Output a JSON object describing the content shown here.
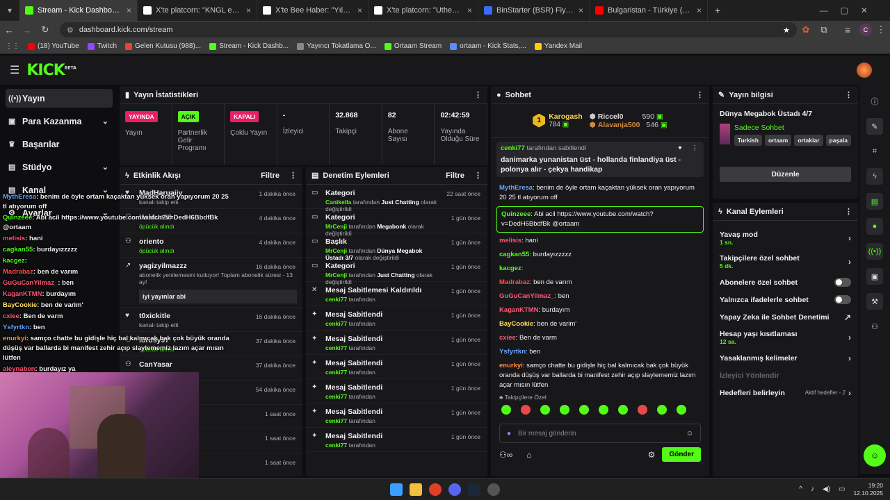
{
  "browser": {
    "tabs": [
      {
        "title": "Stream - Kick Dashboard",
        "icon": "kick-favicon",
        "color": "#53fc18"
      },
      {
        "title": "X'te platcorn: \"KNGL ekibiyle g...",
        "icon": "x-favicon",
        "color": "#ffffff"
      },
      {
        "title": "X'te Bee Haber: \"Yıldız Tilbe, m...",
        "icon": "x-favicon",
        "color": "#ffffff"
      },
      {
        "title": "X'te platcorn: \"Uthenera, KNGL...",
        "icon": "x-favicon",
        "color": "#ffffff"
      },
      {
        "title": "BinStarter (BSR) Fiyatı, Grafikler...",
        "icon": "binstarter-favicon",
        "color": "#3b6cff"
      },
      {
        "title": "Bulgaristan - Türkiye (1-6) Maç...",
        "icon": "youtube-favicon",
        "color": "#ff0000"
      }
    ],
    "url": "dashboard.kick.com/stream",
    "profile_initial": "C",
    "bookmarks": [
      {
        "label": "(18) YouTube",
        "color": "#ff0000"
      },
      {
        "label": "Twitch",
        "color": "#9146ff"
      },
      {
        "label": "Gelen Kutusu (988)...",
        "color": "#ea4335"
      },
      {
        "label": "Stream - Kick Dashb...",
        "color": "#53fc18"
      },
      {
        "label": "Yayıncı Tokatlama O...",
        "color": "#888888"
      },
      {
        "label": "Ortaam Stream",
        "color": "#53fc18"
      },
      {
        "label": "ortaam - Kick Stats,...",
        "color": "#5a8cff"
      },
      {
        "label": "Yandex Mail",
        "color": "#ffcc00"
      }
    ]
  },
  "topnav": {
    "logo": "KICK",
    "logo_sup": "BETA"
  },
  "sidebar": {
    "items": [
      {
        "label": "Yayın",
        "icon": "broadcast-icon",
        "active": true
      },
      {
        "label": "Para Kazanma",
        "icon": "money-icon",
        "chev": true
      },
      {
        "label": "Başarılar",
        "icon": "trophy-icon"
      },
      {
        "label": "Stüdyo",
        "icon": "studio-icon",
        "chev": true
      },
      {
        "label": "Kanal",
        "icon": "channel-icon",
        "chev": true
      },
      {
        "label": "Ayarlar",
        "icon": "gear-icon",
        "chev": true
      }
    ]
  },
  "stats_panel": {
    "title": "Yayın İstatistikleri",
    "items": [
      {
        "badge": "YAYINDA",
        "badge_color": "#e91e63",
        "label": "Yayın"
      },
      {
        "badge": "AÇIK",
        "badge_color": "#53fc18",
        "label": "Partnerlik Gelir Programı"
      },
      {
        "badge": "KAPALI",
        "badge_color": "#e91e63",
        "label": "Çoklu Yayın"
      },
      {
        "value": "-",
        "label": "İzleyici"
      },
      {
        "value": "32.868",
        "label": "Takipçi"
      },
      {
        "value": "82",
        "label": "Abone Sayısı"
      },
      {
        "value": "02:42:59",
        "label": "Yayında Olduğu Süre"
      }
    ]
  },
  "activity": {
    "title": "Etkinlik Akışı",
    "filter": "Filtre",
    "events": [
      {
        "name": "MadHaruaijy",
        "sub": "kanalı takip etti",
        "time": "1 dakika önce",
        "icon": "heart-icon"
      },
      {
        "name": "Haldun90",
        "sub": "öpücük alındı",
        "time": "4 dakika önce",
        "icon": "kiss-icon"
      },
      {
        "name": "oriento",
        "sub": "öpücük alındı",
        "time": "4 dakika önce",
        "icon": "kiss-icon"
      },
      {
        "name": "yagizyilmazzz",
        "sub": "abonelik yenilemesini kutluyor! Toplam abonelik süresi - 13 ay!",
        "time": "16 dakika önce",
        "icon": "sub-icon",
        "note": "iyi yayınlar abi"
      },
      {
        "name": "t0xickitle",
        "sub": "kanalı takip etti",
        "time": "16 dakika önce",
        "icon": "heart-icon"
      },
      {
        "name": "lordsy97",
        "sub": "öpücük alındı",
        "time": "37 dakika önce",
        "icon": "kiss-icon"
      },
      {
        "name": "CanYasar",
        "sub": "",
        "time": "37 dakika önce",
        "icon": "kiss-icon"
      },
      {
        "name": "",
        "sub": "",
        "time": "54 dakika önce",
        "icon": ""
      },
      {
        "name": "",
        "sub": "",
        "time": "1 saat önce",
        "icon": ""
      },
      {
        "name": "",
        "sub": "",
        "time": "1 saat önce",
        "icon": ""
      },
      {
        "name": "",
        "sub": "",
        "time": "1 saat önce",
        "icon": ""
      }
    ]
  },
  "moderation": {
    "title": "Denetim Eylemleri",
    "filter": "Filtre",
    "events": [
      {
        "name": "Kategori",
        "user": "Canikella",
        "mid": "tarafından",
        "target": "Just Chatting",
        "tail": "olarak değiştirildi",
        "time": "22 saat önce",
        "icon": "category-icon"
      },
      {
        "name": "Kategori",
        "user": "MrCenji",
        "mid": "tarafından",
        "target": "Megabonk",
        "tail": "olarak değiştirildi",
        "time": "1 gün önce",
        "icon": "category-icon"
      },
      {
        "name": "Başlık",
        "user": "MrCenji",
        "mid": "tarafından",
        "target": "Dünya Megabok Üstadı 3/7",
        "tail": "olarak değiştirildi",
        "time": "1 gün önce",
        "icon": "title-icon"
      },
      {
        "name": "Kategori",
        "user": "MrCenji",
        "mid": "tarafından",
        "target": "Just Chatting",
        "tail": "olarak değiştirildi",
        "time": "1 gün önce",
        "icon": "category-icon"
      },
      {
        "name": "Mesaj Sabitlemesi Kaldırıldı",
        "user": "cenki77",
        "mid": "tarafından",
        "target": "",
        "tail": "",
        "time": "1 gün önce",
        "icon": "unpin-icon"
      },
      {
        "name": "Mesaj Sabitlendi",
        "user": "cenki77",
        "mid": "tarafından",
        "target": "",
        "tail": "",
        "time": "1 gün önce",
        "icon": "pin-icon"
      },
      {
        "name": "Mesaj Sabitlendi",
        "user": "cenki77",
        "mid": "tarafından",
        "target": "",
        "tail": "",
        "time": "1 gün önce",
        "icon": "pin-icon"
      },
      {
        "name": "Mesaj Sabitlendi",
        "user": "cenki77",
        "mid": "tarafından",
        "target": "",
        "tail": "",
        "time": "1 gün önce",
        "icon": "pin-icon"
      },
      {
        "name": "Mesaj Sabitlendi",
        "user": "cenki77",
        "mid": "tarafından",
        "target": "",
        "tail": "",
        "time": "1 gün önce",
        "icon": "pin-icon"
      },
      {
        "name": "Mesaj Sabitlendi",
        "user": "cenki77",
        "mid": "tarafından",
        "target": "",
        "tail": "",
        "time": "1 gün önce",
        "icon": "pin-icon"
      },
      {
        "name": "Mesaj Sabitlendi",
        "user": "cenki77",
        "mid": "tarafından",
        "target": "",
        "tail": "",
        "time": "1 gün önce",
        "icon": "pin-icon"
      }
    ]
  },
  "chat": {
    "title": "Sohbet",
    "leaders": [
      {
        "rank": "1",
        "name": "Karogash",
        "value": "784"
      },
      {
        "rank": "",
        "name": "Riccel0",
        "value": "590"
      },
      {
        "rank": "",
        "name": "Alavanja500",
        "value": "546"
      }
    ],
    "pinned": {
      "user": "cenki77",
      "by": "tarafından sabitlendi",
      "text": "danimarka yunanistan üst - hollanda finlandiya üst -polonya alır - çekya handikap"
    },
    "messages": [
      {
        "user": "MythEresa",
        "cls": "nm-b",
        "text": ": benim de öyle ortam kaçaktan yüksek oran yapıyorum 20 25 tl atıyorum off"
      },
      {
        "user": "Quinzeee",
        "cls": "nm-g",
        "text": ": Abi acil https://www.youtube.com/watch?v=DedH6BbdfBk @ortaam",
        "highlight": true
      },
      {
        "user": "melisis",
        "cls": "nm-p",
        "text": ": hani"
      },
      {
        "user": "cagkan55",
        "cls": "nm-g",
        "text": ": burdayızzzzz"
      },
      {
        "user": "kacgez",
        "cls": "nm-g",
        "text": ":"
      },
      {
        "user": "Madrabaz",
        "cls": "nm-r",
        "text": ": ben de varım"
      },
      {
        "user": "GuGuCanYilmaz_",
        "cls": "nm-p",
        "text": ": ben"
      },
      {
        "user": "KaganKTMN",
        "cls": "nm-p",
        "text": ": burdayım"
      },
      {
        "user": "BayCookie",
        "cls": "nm-y",
        "text": ": ben de varim'"
      },
      {
        "user": "cxiee",
        "cls": "nm-p",
        "text": ": Ben de varm"
      },
      {
        "user": "Ysfyrtkn",
        "cls": "nm-b",
        "text": ": ben"
      },
      {
        "user": "enurkyi",
        "cls": "nm-o",
        "text": ": samço chatte bu gidişle hiç bal kalmıcak bak çok büyük oranda düşüş var ballarda bi manifest zehir açıp slaylememiz lazım açar mısın lütfen"
      },
      {
        "user": "aleynaben",
        "cls": "nm-p",
        "text": ": burdayız ya"
      }
    ],
    "emote_label": "Takipçilere Özel",
    "input_placeholder": "Bir mesaj gönderin",
    "send": "Gönder"
  },
  "stream_info": {
    "title": "Yayın bilgisi",
    "stream_title": "Dünya Megabok Üstadı 4/7",
    "category": "Sadece Sohbet",
    "tags": [
      "Turkish",
      "ortaam",
      "ortaklar",
      "paşala"
    ],
    "edit": "Düzenle"
  },
  "channel_actions": {
    "title": "Kanal Eylemleri",
    "items": [
      {
        "label": "Yavaş mod",
        "sub": "1 sn.",
        "control": "arrow"
      },
      {
        "label": "Takipçilere özel sohbet",
        "sub": "5 dk.",
        "control": "arrow"
      },
      {
        "label": "Abonelere özel sohbet",
        "sub": "",
        "control": "toggle"
      },
      {
        "label": "Yalnızca ifadelerle sohbet",
        "sub": "",
        "control": "toggle"
      },
      {
        "label": "Yapay Zeka ile Sohbet Denetimi",
        "sub": "",
        "control": "external"
      },
      {
        "label": "Hesap yaşı kısıtlaması",
        "sub": "12 sa.",
        "control": "arrow"
      },
      {
        "label": "Yasaklanmış kelimeler",
        "sub": "",
        "control": "arrow"
      },
      {
        "label": "İzleyici Yönlendir",
        "sub": "",
        "control": "none",
        "disabled": true
      },
      {
        "label": "Hedefleri belirleyin",
        "sub": "",
        "control": "arrow",
        "extra": "Aktif hedefler - 2"
      }
    ]
  },
  "taskbar": {
    "time": "19:20",
    "date": "12.10.2025"
  }
}
